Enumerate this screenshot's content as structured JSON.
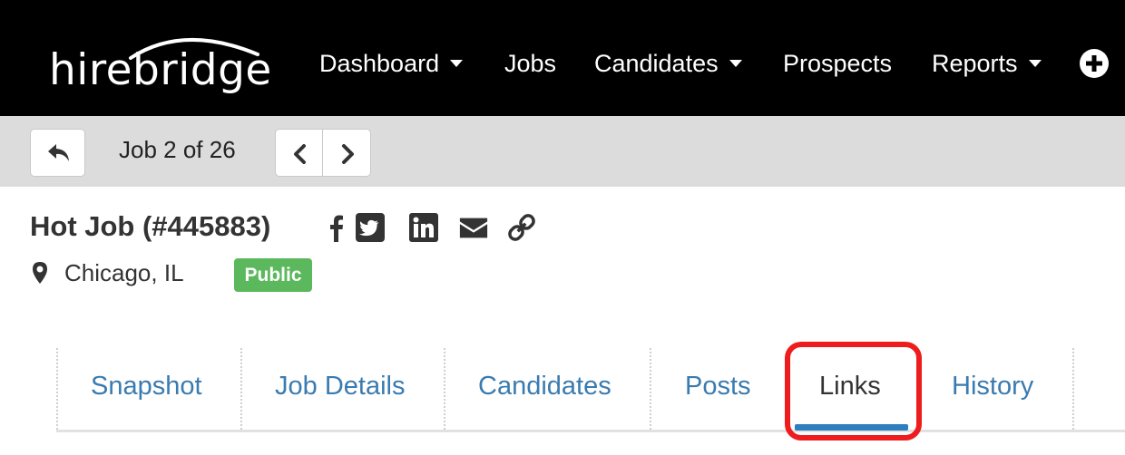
{
  "brand": {
    "logo_text": "hirebridge"
  },
  "nav": {
    "items": [
      {
        "label": "Dashboard",
        "dropdown": true
      },
      {
        "label": "Jobs",
        "dropdown": false
      },
      {
        "label": "Candidates",
        "dropdown": true
      },
      {
        "label": "Prospects",
        "dropdown": false
      },
      {
        "label": "Reports",
        "dropdown": true
      }
    ],
    "add_icon": "plus-circle-icon"
  },
  "pager": {
    "back_icon": "reply-arrow-icon",
    "text": "Job 2 of 26",
    "prev_icon": "chevron-left-icon",
    "next_icon": "chevron-right-icon"
  },
  "job": {
    "title": "Hot Job (#445883)",
    "share_icons": [
      "facebook-icon",
      "twitter-icon",
      "linkedin-icon",
      "email-icon",
      "link-icon"
    ],
    "location": "Chicago, IL",
    "location_icon": "map-pin-icon",
    "status_badge": "Public"
  },
  "tabs": {
    "items": [
      "Snapshot",
      "Job Details",
      "Candidates",
      "Posts",
      "Links",
      "History"
    ],
    "active": "Links"
  },
  "colors": {
    "navbar": "#000000",
    "toolbar": "#dcdcdc",
    "tab_link": "#3a7bb0",
    "active_underline": "#2e7fc0",
    "badge": "#5cb85c",
    "highlight": "#ee1c1c"
  }
}
